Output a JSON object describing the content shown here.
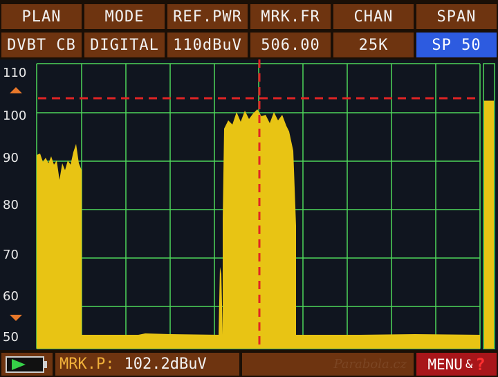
{
  "header": {
    "labels": [
      "PLAN",
      "MODE",
      "REF.PWR",
      "MRK.FR",
      "CHAN",
      "SPAN"
    ],
    "values": [
      "DVBT CB",
      "DIGITAL",
      "110dBuV",
      "506.00",
      "25K",
      "SP 50"
    ],
    "selected_index": 5
  },
  "y_axis": {
    "ticks": [
      "110",
      "100",
      "90",
      "80",
      "70",
      "60",
      "50"
    ]
  },
  "spectrum": {
    "reference_level_dbuv": 103,
    "marker_level_dbuv": 102.2,
    "level_bar_fraction": 0.87
  },
  "footer": {
    "marker_label": "MRK.P:",
    "marker_value": "102.2dBuV",
    "menu_label": "MENU",
    "menu_amp": "&",
    "help_symbol": "?",
    "watermark": "Parabola.cz"
  },
  "colors": {
    "header_bg": "#6e3410",
    "selected_bg": "#2d5be0",
    "trace": "#e8c414",
    "grid": "#4ed65a",
    "marker": "#e02424",
    "menu_bg": "#a8161a"
  }
}
